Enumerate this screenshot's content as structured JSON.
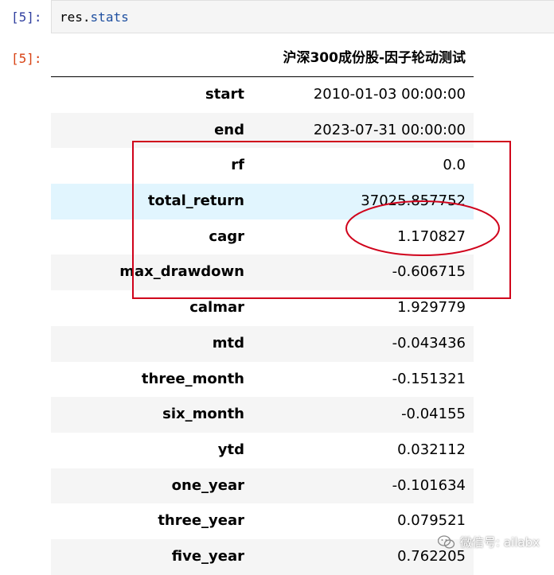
{
  "cells": {
    "in_prompt": "[5]:",
    "out_prompt": "[5]:",
    "code": {
      "var": "res",
      "dot": ".",
      "attr": "stats"
    }
  },
  "table": {
    "column_header": "沪深300成份股-因子轮动测试",
    "rows": [
      {
        "label": "start",
        "value": "2010-01-03 00:00:00"
      },
      {
        "label": "end",
        "value": "2023-07-31 00:00:00"
      },
      {
        "label": "rf",
        "value": "0.0"
      },
      {
        "label": "total_return",
        "value": "37025.857752"
      },
      {
        "label": "cagr",
        "value": "1.170827"
      },
      {
        "label": "max_drawdown",
        "value": "-0.606715"
      },
      {
        "label": "calmar",
        "value": "1.929779"
      },
      {
        "label": "mtd",
        "value": "-0.043436"
      },
      {
        "label": "three_month",
        "value": "-0.151321"
      },
      {
        "label": "six_month",
        "value": "-0.04155"
      },
      {
        "label": "ytd",
        "value": "0.032112"
      },
      {
        "label": "one_year",
        "value": "-0.101634"
      },
      {
        "label": "three_year",
        "value": "0.079521"
      },
      {
        "label": "five_year",
        "value": "0.762205"
      }
    ]
  },
  "annotations": {
    "color": "#d0021b"
  },
  "watermark": {
    "text": "微信号: ailabx",
    "icon": "wechat-icon"
  }
}
